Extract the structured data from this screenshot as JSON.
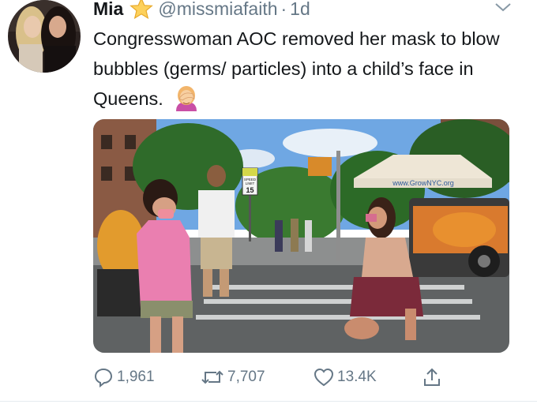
{
  "tweet": {
    "display_name": "Mia",
    "handle": "@missmiafaith",
    "separator": "·",
    "time": "1d",
    "text": "Congresswoman AOC removed her mask to blow bubbles (germs/ particles) into a child’s face in Queens."
  },
  "media": {
    "signs": {
      "speed_top": "SPEED",
      "speed_mid": "LIMIT",
      "speed_value": "15",
      "tent_banner": "www.GrowNYC.org"
    }
  },
  "actions": {
    "replies": "1,961",
    "retweets": "7,707",
    "likes": "13.4K"
  },
  "colors": {
    "text": "#14171a",
    "secondary": "#657786",
    "divider": "#e6ecf0"
  },
  "icons": [
    "star-emoji-icon",
    "caret-down-icon",
    "facepalm-emoji-icon",
    "reply-icon",
    "retweet-icon",
    "like-icon",
    "share-icon"
  ]
}
